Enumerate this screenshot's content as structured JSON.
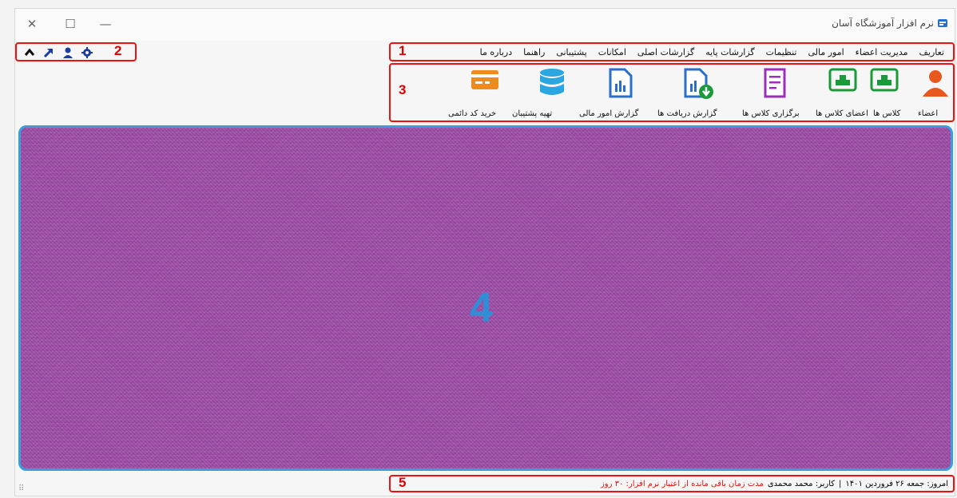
{
  "window": {
    "title": "نرم افزار آموزشگاه آسان",
    "controls": {
      "close": "✕",
      "maximize": "☐",
      "minimize": "—"
    }
  },
  "menu": {
    "items": [
      "تعاریف",
      "مدیریت اعضاء",
      "امور مالی",
      "تنظیمات",
      "گزارشات پایه",
      "گزارشات اصلی",
      "امکانات",
      "پشتیبانی",
      "راهنما",
      "درباره ما"
    ]
  },
  "toolbar": {
    "icons": [
      "chevron-up-icon",
      "arrow-up-right-icon",
      "user-icon",
      "gear-icon"
    ]
  },
  "ribbon": {
    "buttons": [
      {
        "label": "اعضاء",
        "icon": "member-icon",
        "color": "#e8571e"
      },
      {
        "label": "کلاس ها",
        "icon": "class-icon",
        "color": "#1a9a3a"
      },
      {
        "label": "اعضای کلاس ها",
        "icon": "class-members-icon",
        "color": "#1a9a3a"
      },
      {
        "label": "برگزاری کلاس ها",
        "icon": "document-icon",
        "color": "#9b2fb7"
      },
      {
        "label": "گزارش دریافت ها",
        "icon": "report-download-icon",
        "color": "#2a6fc9"
      },
      {
        "label": "گزارش امور مالی",
        "icon": "report-chart-icon",
        "color": "#2a6fc9"
      },
      {
        "label": "تهیه پشتیبان",
        "icon": "database-icon",
        "color": "#2aa6e0"
      },
      {
        "label": "خرید کد دائمی",
        "icon": "credit-card-icon",
        "color": "#f08a1c"
      }
    ]
  },
  "labels": {
    "l1": "1",
    "l2": "2",
    "l3": "3",
    "l4": "4",
    "l5": "5"
  },
  "status": {
    "date": "امروز: جمعه ۲۶ فروردین ۱۴۰۱",
    "separator": "|",
    "user": "کاربر: محمد محمدی",
    "remaining": "مدت زمان باقی مانده از اعتبار نرم افزار: ۳۰ روز"
  },
  "colors": {
    "accent_blue": "#3a9dde",
    "annotation_red": "#e00000",
    "background_purple": "#9a4aa4"
  }
}
